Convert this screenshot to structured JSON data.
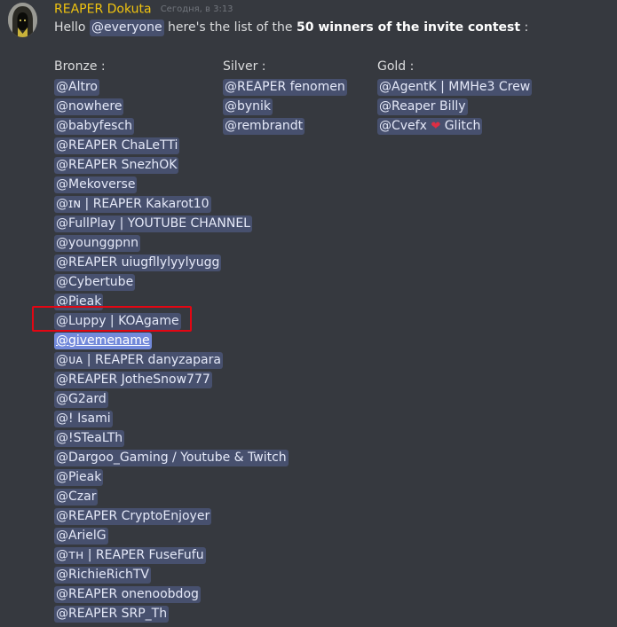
{
  "message": {
    "author": "REAPER Dokuta",
    "timestamp": "Сегодня, в 3:13",
    "intro": {
      "hello": "Hello",
      "mention": "@everyone",
      "text_before": "here's the list of the",
      "bold": "50 winners of the invite contest",
      "text_after": ":"
    }
  },
  "colors": {
    "author": "#f1c40f",
    "mention_bg": "rgba(114,137,218,0.30)",
    "highlight_border": "#e30613"
  },
  "columns": {
    "bronze": {
      "title": "Bronze :",
      "winners": [
        "@Altro",
        "@nowhere",
        "@babyfesch",
        "@REAPER ChaLeTTi",
        "@REAPER SnezhOK",
        "@Mekoverse",
        "@ɪɴ | REAPER Kakarot10",
        "@FullPlay | YOUTUBE CHANNEL",
        "@younggpnn",
        "@REAPER uiugfllylyylyugg",
        "@Cybertube",
        "@Pieak",
        "@Luppy | KOAgame",
        "@givemename",
        "@ᴜᴀ | REAPER danyzapara",
        "@REAPER JotheSnow777",
        "@G2ard",
        "@! Isami",
        "@!STeaLTh",
        "@Dargoo_Gaming / Youtube & Twitch",
        "@Pieak",
        "@Czar",
        "@REAPER CryptoEnjoyer",
        "@ArielG",
        "@ᴛʜ | REAPER FuseFufu",
        "@RichieRichTV",
        "@REAPER onenoobdog",
        "@REAPER SRP_Th"
      ]
    },
    "silver": {
      "title": "Silver :",
      "winners": [
        "@REAPER fenomen",
        "@bynik",
        "@rembrandt"
      ]
    },
    "gold": {
      "title": "Gold :",
      "winners": [
        "@AgentK | MMHe3 Crew",
        "@Reaper Billy",
        "@Cvefx ❤ Glitch"
      ]
    }
  },
  "icons": {
    "avatar": "hooded-reaper-avatar",
    "heart": "heart-icon"
  }
}
